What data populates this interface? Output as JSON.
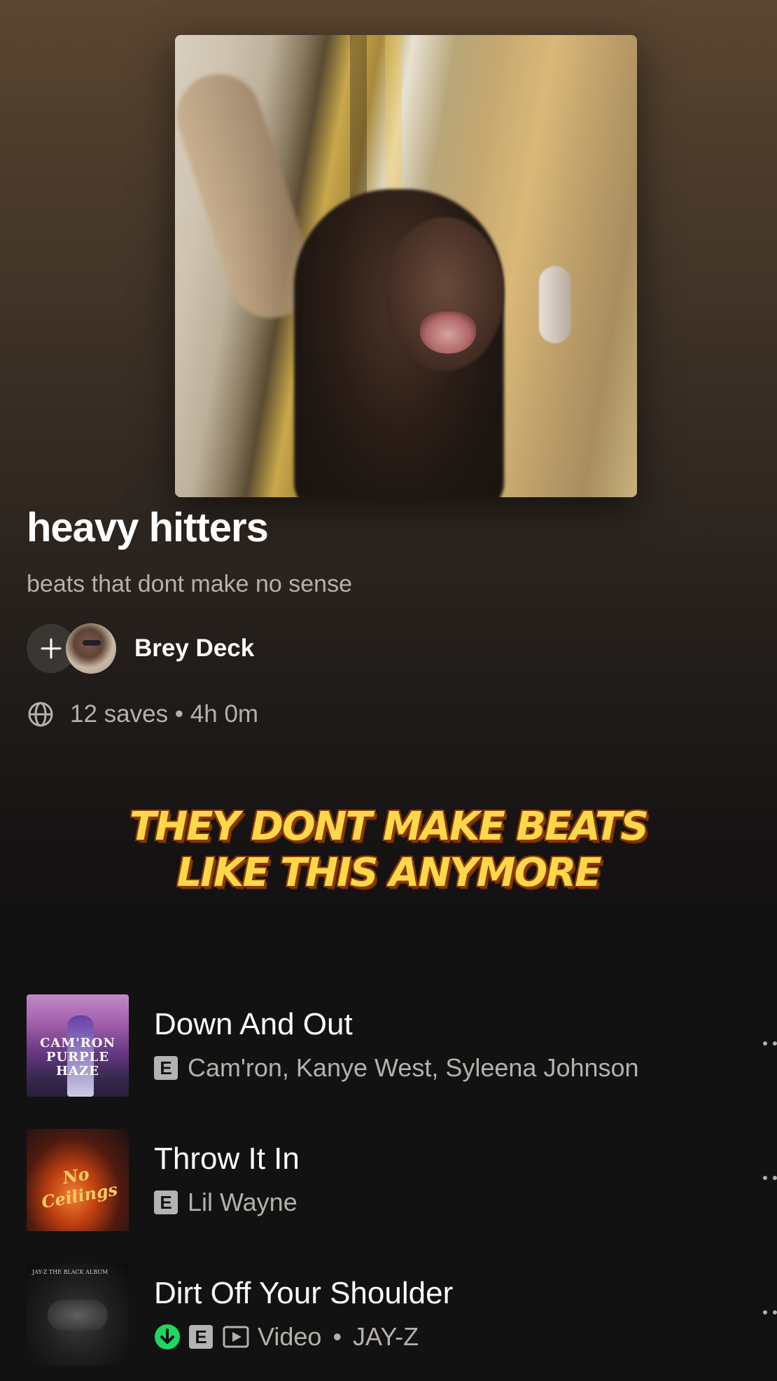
{
  "playlist": {
    "title": "heavy hitters",
    "description": "beats that dont make no sense",
    "owner": "Brey Deck",
    "meta": "12 saves • 4h 0m"
  },
  "overlay": {
    "line1": "THEY DONT MAKE BEATS",
    "line2": "LIKE THIS ANYMORE"
  },
  "tracks": [
    {
      "title": "Down And Out",
      "explicit": "E",
      "artists": "Cam'ron, Kanye West, Syleena Johnson",
      "art_label": "CAM'RON PURPLE HAZE",
      "art_icon": "camron-purple-haze-cover"
    },
    {
      "title": "Throw It In",
      "explicit": "E",
      "artists": "Lil Wayne",
      "art_label": "No Ceilings",
      "art_icon": "no-ceilings-cover"
    },
    {
      "title": "Dirt Off Your Shoulder",
      "explicit": "E",
      "type": "Video",
      "separator": "•",
      "artists": "JAY-Z",
      "downloaded": true,
      "art_label": "JAY-Z THE BLACK ALBUM",
      "art_icon": "black-album-cover"
    }
  ],
  "colors": {
    "background": "#121212",
    "header_gradient_top": "#5b4630",
    "caption_fill": "#ffd84a",
    "caption_stroke": "#8a3a0a",
    "download_green": "#1ed760"
  }
}
